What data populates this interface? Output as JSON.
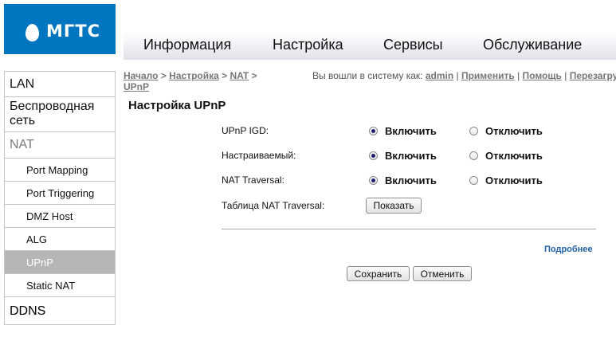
{
  "brand": {
    "logo_text": "МГТС"
  },
  "topnav": {
    "tabs": [
      {
        "label": "Информация"
      },
      {
        "label": "Настройка"
      },
      {
        "label": "Сервисы"
      },
      {
        "label": "Обслуживание"
      }
    ]
  },
  "sidebar": {
    "items": [
      {
        "label": "LAN"
      },
      {
        "label": "Беспроводная сеть"
      },
      {
        "label": "NAT"
      },
      {
        "label": "Port Mapping"
      },
      {
        "label": "Port Triggering"
      },
      {
        "label": "DMZ Host"
      },
      {
        "label": "ALG"
      },
      {
        "label": "UPnP",
        "active": true
      },
      {
        "label": "Static NAT"
      },
      {
        "label": "DDNS"
      }
    ]
  },
  "breadcrumb": {
    "items": [
      "Начало",
      "Настройка",
      "NAT",
      "UPnP"
    ],
    "separator": " > "
  },
  "header": {
    "logged_in_text": "Вы вошли в систему как:",
    "user": "admin",
    "links": [
      "Применить",
      "Помощь",
      "Перезагрузка"
    ]
  },
  "page": {
    "title": "Настройка UPnP",
    "rows": [
      {
        "label": "UPnP IGD:",
        "on_label": "Включить",
        "off_label": "Отключить",
        "value": "on"
      },
      {
        "label": "Настраиваемый:",
        "on_label": "Включить",
        "off_label": "Отключить",
        "value": "on"
      },
      {
        "label": "NAT Traversal:",
        "on_label": "Включить",
        "off_label": "Отключить",
        "value": "on"
      }
    ],
    "table_row": {
      "label": "Таблица NAT Traversal:",
      "button": "Показать"
    },
    "more_link": "Подробнее",
    "save_button": "Сохранить",
    "cancel_button": "Отменить"
  }
}
